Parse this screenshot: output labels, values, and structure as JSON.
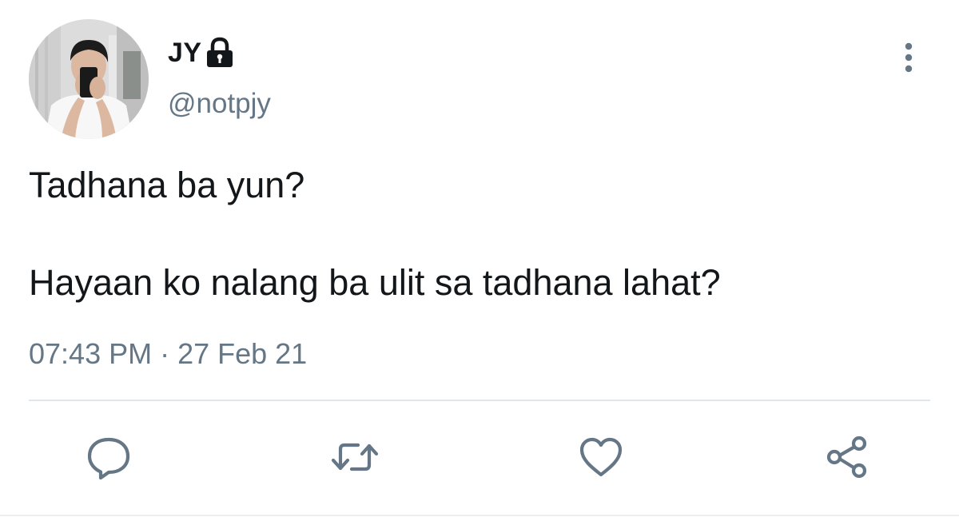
{
  "tweet": {
    "author": {
      "display_name": "JY",
      "handle": "@notpjy",
      "protected_icon": "lock-icon",
      "avatar_icon": "profile-photo"
    },
    "text_lines": [
      "Tadhana ba yun?",
      "Hayaan ko nalang ba ulit sa tadhana lahat?"
    ],
    "timestamp": "07:43 PM · 27 Feb 21",
    "menu_icon": "more-vertical-icon",
    "actions": [
      {
        "name": "reply",
        "icon": "reply-icon"
      },
      {
        "name": "retweet",
        "icon": "retweet-icon"
      },
      {
        "name": "like",
        "icon": "heart-icon"
      },
      {
        "name": "share",
        "icon": "share-icon"
      }
    ]
  },
  "colors": {
    "text_primary": "#14171a",
    "text_secondary": "#657786",
    "icon": "#657786",
    "divider": "#e1e8ed",
    "background": "#ffffff"
  }
}
